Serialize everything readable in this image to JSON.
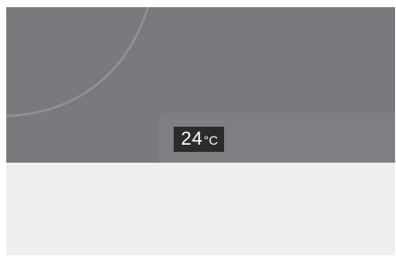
{
  "display": {
    "temperature": {
      "value": "24",
      "unit": "°C"
    }
  },
  "colors": {
    "display_background": "#787a7d",
    "readout_background": "#2b2b2b",
    "readout_text": "#ffffff",
    "lower_area": "#eeeeee"
  }
}
